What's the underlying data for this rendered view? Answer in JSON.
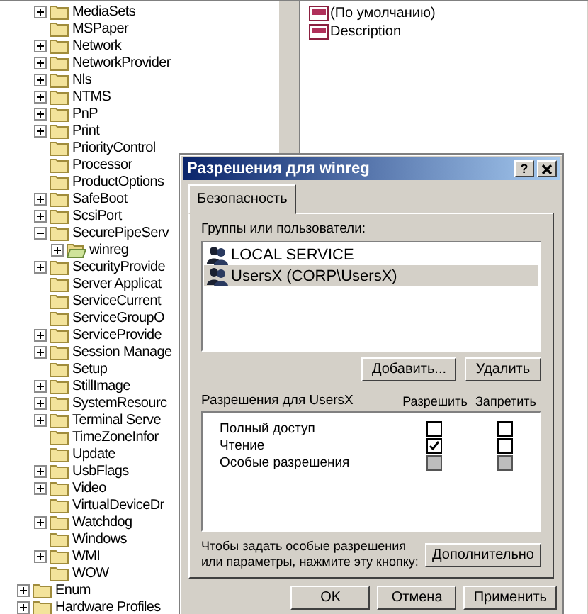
{
  "tree": {
    "items": [
      {
        "label": "MediaSets",
        "has_children": true,
        "expanded": false,
        "selected": false
      },
      {
        "label": "MSPaper",
        "has_children": false,
        "selected": false
      },
      {
        "label": "Network",
        "has_children": true,
        "expanded": false,
        "selected": false
      },
      {
        "label": "NetworkProvider",
        "has_children": true,
        "expanded": false,
        "selected": false
      },
      {
        "label": "Nls",
        "has_children": true,
        "expanded": false,
        "selected": false
      },
      {
        "label": "NTMS",
        "has_children": true,
        "expanded": false,
        "selected": false
      },
      {
        "label": "PnP",
        "has_children": true,
        "expanded": false,
        "selected": false
      },
      {
        "label": "Print",
        "has_children": true,
        "expanded": false,
        "selected": false
      },
      {
        "label": "PriorityControl",
        "has_children": false,
        "selected": false
      },
      {
        "label": "Processor",
        "has_children": false,
        "selected": false
      },
      {
        "label": "ProductOptions",
        "has_children": false,
        "selected": false
      },
      {
        "label": "SafeBoot",
        "has_children": true,
        "expanded": false,
        "selected": false
      },
      {
        "label": "ScsiPort",
        "has_children": true,
        "expanded": false,
        "selected": false
      },
      {
        "label": "SecurePipeServ",
        "has_children": true,
        "expanded": true,
        "selected": false,
        "children": [
          {
            "label": "winreg",
            "has_children": true,
            "expanded": false,
            "selected": true
          }
        ]
      },
      {
        "label": "SecurityProvide",
        "has_children": true,
        "expanded": false,
        "selected": false
      },
      {
        "label": "Server Applicat",
        "has_children": false,
        "selected": false
      },
      {
        "label": "ServiceCurrent",
        "has_children": false,
        "selected": false
      },
      {
        "label": "ServiceGroupO",
        "has_children": false,
        "selected": false
      },
      {
        "label": "ServiceProvide",
        "has_children": true,
        "expanded": false,
        "selected": false
      },
      {
        "label": "Session Manage",
        "has_children": true,
        "expanded": false,
        "selected": false
      },
      {
        "label": "Setup",
        "has_children": false,
        "selected": false
      },
      {
        "label": "StillImage",
        "has_children": true,
        "expanded": false,
        "selected": false
      },
      {
        "label": "SystemResourc",
        "has_children": true,
        "expanded": false,
        "selected": false
      },
      {
        "label": "Terminal Serve",
        "has_children": true,
        "expanded": false,
        "selected": false
      },
      {
        "label": "TimeZoneInfor",
        "has_children": false,
        "selected": false
      },
      {
        "label": "Update",
        "has_children": false,
        "selected": false
      },
      {
        "label": "UsbFlags",
        "has_children": true,
        "expanded": false,
        "selected": false
      },
      {
        "label": "Video",
        "has_children": true,
        "expanded": false,
        "selected": false
      },
      {
        "label": "VirtualDeviceDr",
        "has_children": false,
        "selected": false
      },
      {
        "label": "Watchdog",
        "has_children": true,
        "expanded": false,
        "selected": false
      },
      {
        "label": "Windows",
        "has_children": false,
        "selected": false
      },
      {
        "label": "WMI",
        "has_children": true,
        "expanded": false,
        "selected": false
      },
      {
        "label": "WOW",
        "has_children": false,
        "selected": false
      }
    ],
    "parent_siblings": [
      {
        "label": "Enum",
        "has_children": true,
        "expanded": false,
        "selected": false
      },
      {
        "label": "Hardware Profiles",
        "has_children": true,
        "expanded": false,
        "selected": false
      }
    ]
  },
  "values": [
    {
      "name": "(По умолчанию)"
    },
    {
      "name": "Description"
    }
  ],
  "dialog": {
    "title": "Разрешения для winreg",
    "help": "?",
    "tabs": [
      {
        "label": "Безопасность",
        "selected": true
      }
    ],
    "groups_label": "Группы или пользователи:",
    "groups": [
      {
        "name": "LOCAL SERVICE",
        "selected": false
      },
      {
        "name": "UsersX (CORP\\UsersX)",
        "selected": true
      }
    ],
    "group_buttons": [
      "Добавить...",
      "Удалить"
    ],
    "permissions_label": "Разрешения для UsersX",
    "allow_label": "Разрешить",
    "deny_label": "Запретить",
    "permissions": [
      {
        "name": "Полный доступ",
        "allow": {
          "checked": false,
          "disabled": false
        },
        "deny": {
          "checked": false,
          "disabled": false
        }
      },
      {
        "name": "Чтение",
        "allow": {
          "checked": true,
          "disabled": false
        },
        "deny": {
          "checked": false,
          "disabled": false
        }
      },
      {
        "name": "Особые разрешения",
        "allow": {
          "checked": false,
          "disabled": true
        },
        "deny": {
          "checked": false,
          "disabled": true
        }
      }
    ],
    "advanced_hint": "Чтобы задать особые разрешения или параметры, нажмите эту кнопку:",
    "advanced_button": "Дополнительно",
    "buttons": [
      "OK",
      "Отмена",
      "Применить"
    ]
  }
}
